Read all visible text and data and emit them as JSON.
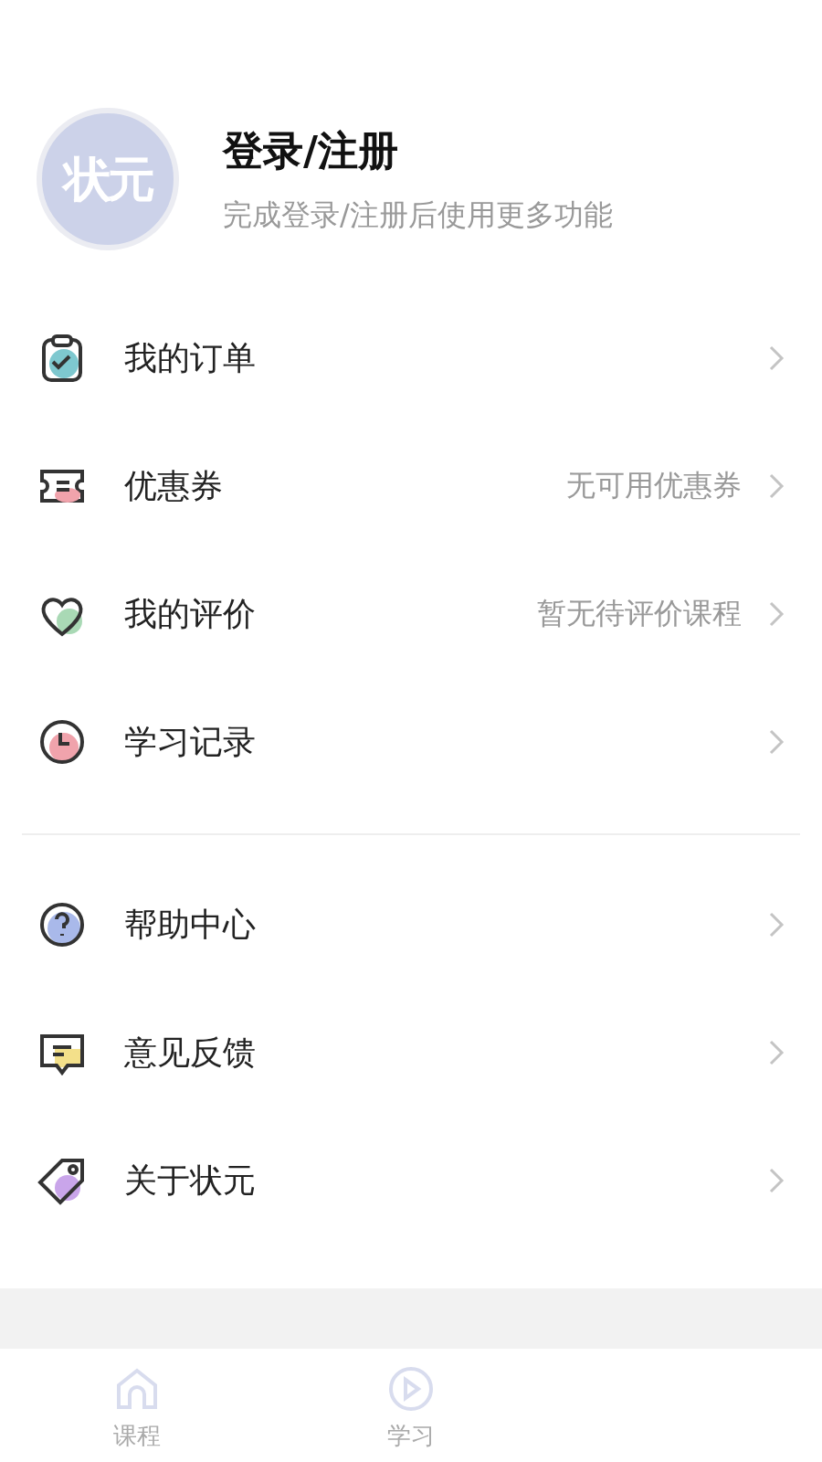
{
  "profile": {
    "avatar_text": "状元",
    "title": "登录/注册",
    "subtitle": "完成登录/注册后使用更多功能"
  },
  "menu_groups": [
    {
      "items": [
        {
          "label": "我的订单"
        },
        {
          "label": "优惠券",
          "value": "无可用优惠券"
        },
        {
          "label": "我的评价",
          "value": "暂无待评价课程"
        },
        {
          "label": "学习记录"
        }
      ]
    },
    {
      "items": [
        {
          "label": "帮助中心"
        },
        {
          "label": "意见反馈"
        },
        {
          "label": "关于状元"
        }
      ]
    }
  ],
  "tab_bar": [
    {
      "label": "课程",
      "selected": false
    },
    {
      "label": "学习",
      "selected": false
    }
  ]
}
